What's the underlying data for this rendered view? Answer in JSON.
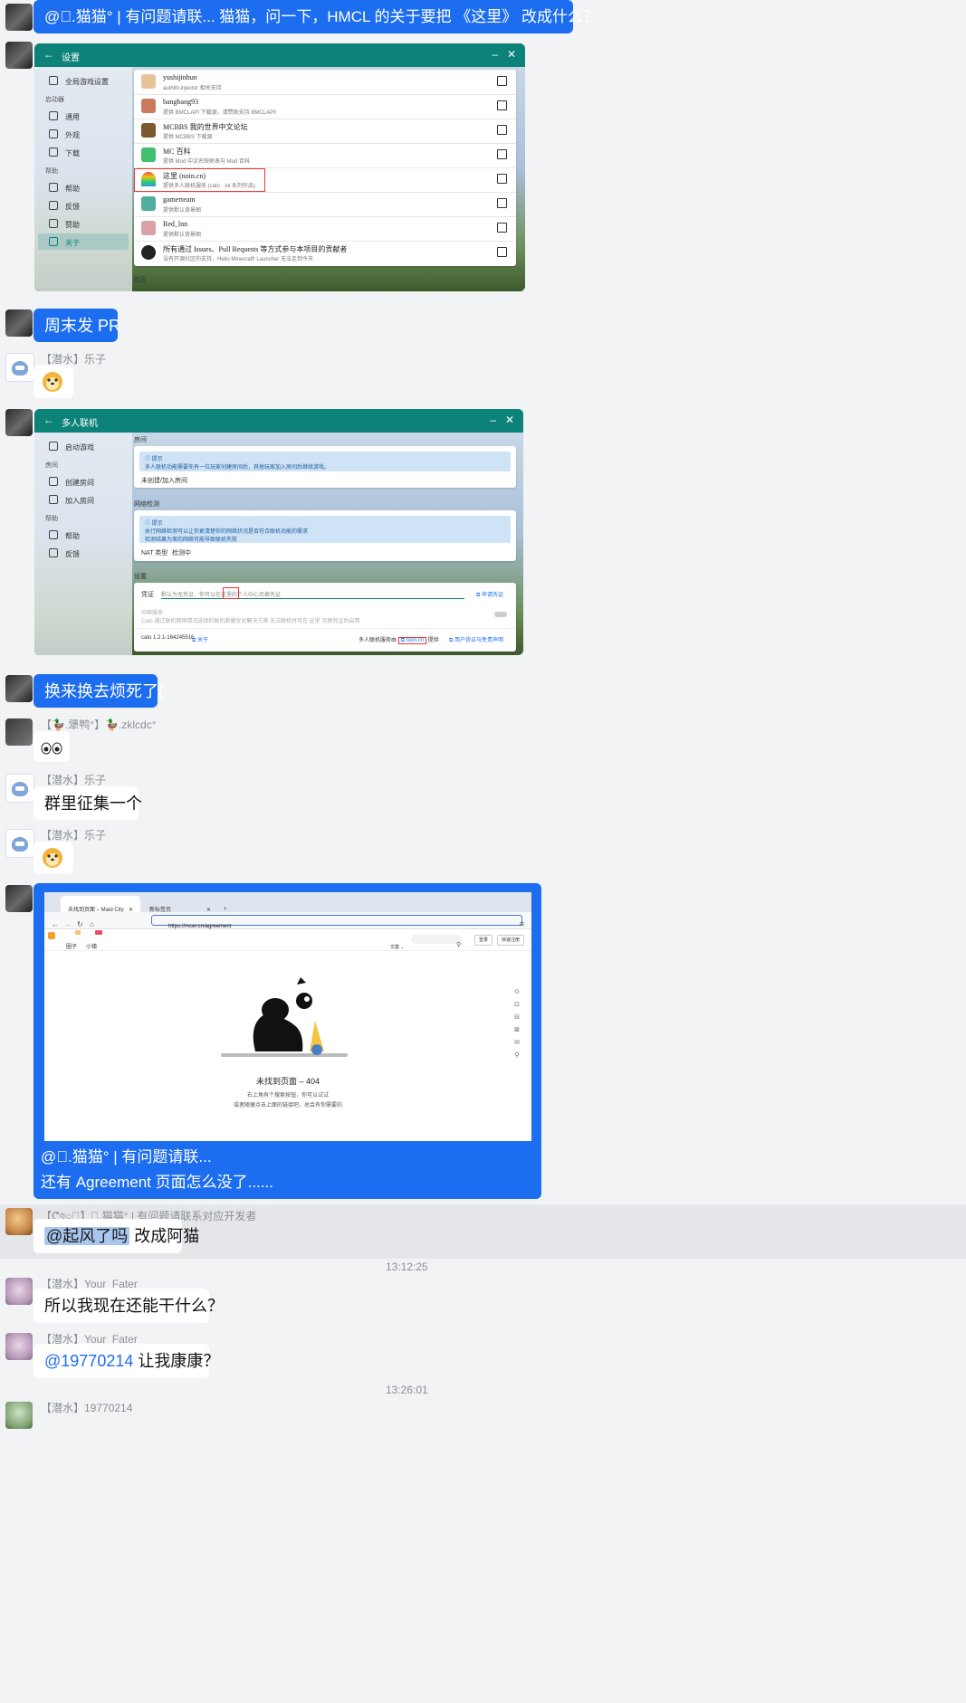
{
  "messages": [
    {
      "text": "@\u0000.猫猫° | 有问题请联...   猫猫，问一下，HMCL 的关于要把 《这里》 改成什么？"
    },
    {
      "text": "周末发 PR"
    },
    {
      "sender": "【潜水】乐子",
      "emoji": "doge"
    },
    {
      "text": "换来换去烦死了("
    },
    {
      "sender": "【🦆.犟鸭°】🦆.zklcdc°",
      "emoji": "eyes"
    },
    {
      "sender": "【潜水】乐子",
      "text": "群里征集一个"
    },
    {
      "sender": "【潜水】乐子",
      "emoji": "doge"
    },
    {
      "caption_line1": "@\u0000.猫猫° | 有问题请联...",
      "caption_line2": "还有 Agreement 页面怎么没了......"
    },
    {
      "sender": "【ᕦ᠀○\u0000】\u0000.猫猫° | 有问题请联系对应开发者",
      "mention": "@起风了吗",
      "text": " 改成阿猫"
    },
    {
      "time": "13:12:25"
    },
    {
      "sender": "【潜水】Your_Fater",
      "text": "所以我现在还能干什么？"
    },
    {
      "sender": "【潜水】Your_Fater",
      "mention": "@19770214",
      "text": " 让我康康？"
    },
    {
      "time": "13:26:01"
    },
    {
      "sender": "【潜水】19770214"
    }
  ],
  "shot1": {
    "title": "设置",
    "sidebar": {
      "global": "全局游戏设置",
      "h_launcher": "启动器",
      "general": "通用",
      "appearance": "外观",
      "download": "下载",
      "h_help": "帮助",
      "help": "帮助",
      "feedback": "反馈",
      "sponsor": "赞助",
      "about": "关于"
    },
    "items": [
      {
        "name": "yushijinhun",
        "desc": "authlib-injector 相关支持",
        "color": "#e8c39a"
      },
      {
        "name": "bangbang93",
        "desc": "提供 BMCLAPI 下载源，请赞助支持 BMCLAPI!",
        "color": "#c77b5a"
      },
      {
        "name": "MCBBS 我的世界中文论坛",
        "desc": "提供 MCBBS 下载源",
        "color": "#7b5a2e"
      },
      {
        "name": "MC 百科",
        "desc": "提供 Mod 中文名映射表与 Mod 百科",
        "color": "#3fbf6f"
      },
      {
        "name": "这里 (noin.cn)",
        "desc": "提供多人联机服务 (cato · ioi 系列作品)",
        "color": "#f0b040"
      },
      {
        "name": "gamerteam",
        "desc": "提供默认背景图",
        "color": "#4fae9c"
      },
      {
        "name": "Red_lnn",
        "desc": "提供默认背景图",
        "color": "#d9a0a8"
      },
      {
        "name": "所有通过 Issues、Pull Requests 等方式参与本项目的贡献者",
        "desc": "没有开源社区的支持，Hello Minecraft! Launcher 无法走到今天",
        "color": "#222222"
      }
    ],
    "footer": "社区"
  },
  "shot2": {
    "title": "多人联机",
    "sidebar": {
      "launch": "启动游戏",
      "h_room": "房间",
      "create": "创建房间",
      "join": "加入房间",
      "h_help": "帮助",
      "help": "帮助",
      "feedback": "反馈"
    },
    "sec_room": "房间",
    "tip1_title": "ⓘ 提示",
    "tip1_text": "多人联机功能需要先有一位玩家创建房间后，其他玩家加入房间后继续游戏。",
    "room_status": "未创建/加入房间",
    "sec_net": "网络检测",
    "tip2_title": "ⓘ 提示",
    "tip2_line1": "执行网络检测可以让你更清楚你的网络状况是否符合联机功能的需求",
    "tip2_line2": "检测结果为差的网络可能导致联机失败",
    "nat_label": "NAT 类型",
    "nat_value": "检测中",
    "sec_settings": "设置",
    "token_label": "凭证",
    "token_placeholder": "默认为无凭证，你可以在这里的个人中心另换凭证",
    "apply_token": "申请凭证",
    "relay_label": "中继服务",
    "relay_desc": "Cato 通过联机网络情况选择的联机质量优化解决方案  无法联机时可在 这里 另换凭证后启用",
    "version": "cato 1.2.1-164245516",
    "about": "关于",
    "provider_prefix": "多人联机服务由",
    "provider_link": "noin.cn",
    "provider_suffix": "提供",
    "agreement": "用户协议与免责声明"
  },
  "shot3": {
    "tab1": "未找到页面 – Maid City",
    "tab2": "新标签页",
    "url": "https://mcer.cn/agreement",
    "nav1": "圈子",
    "nav2": "小镇",
    "nav1_badge": "",
    "nav2_badge": "",
    "lang": "文案 ⌄",
    "login": "登录",
    "register": "快速注册",
    "heading": "未找到页面 – 404",
    "sub1": "右上角有个搜索按钮，你可以试试",
    "sub2": "或者随便点击上面的链接吧，总会有你需要的"
  },
  "colors": {
    "bubble_blue": "#1d6df0",
    "hmcl_teal": "#0d8278",
    "background": "#f1f3f5"
  }
}
